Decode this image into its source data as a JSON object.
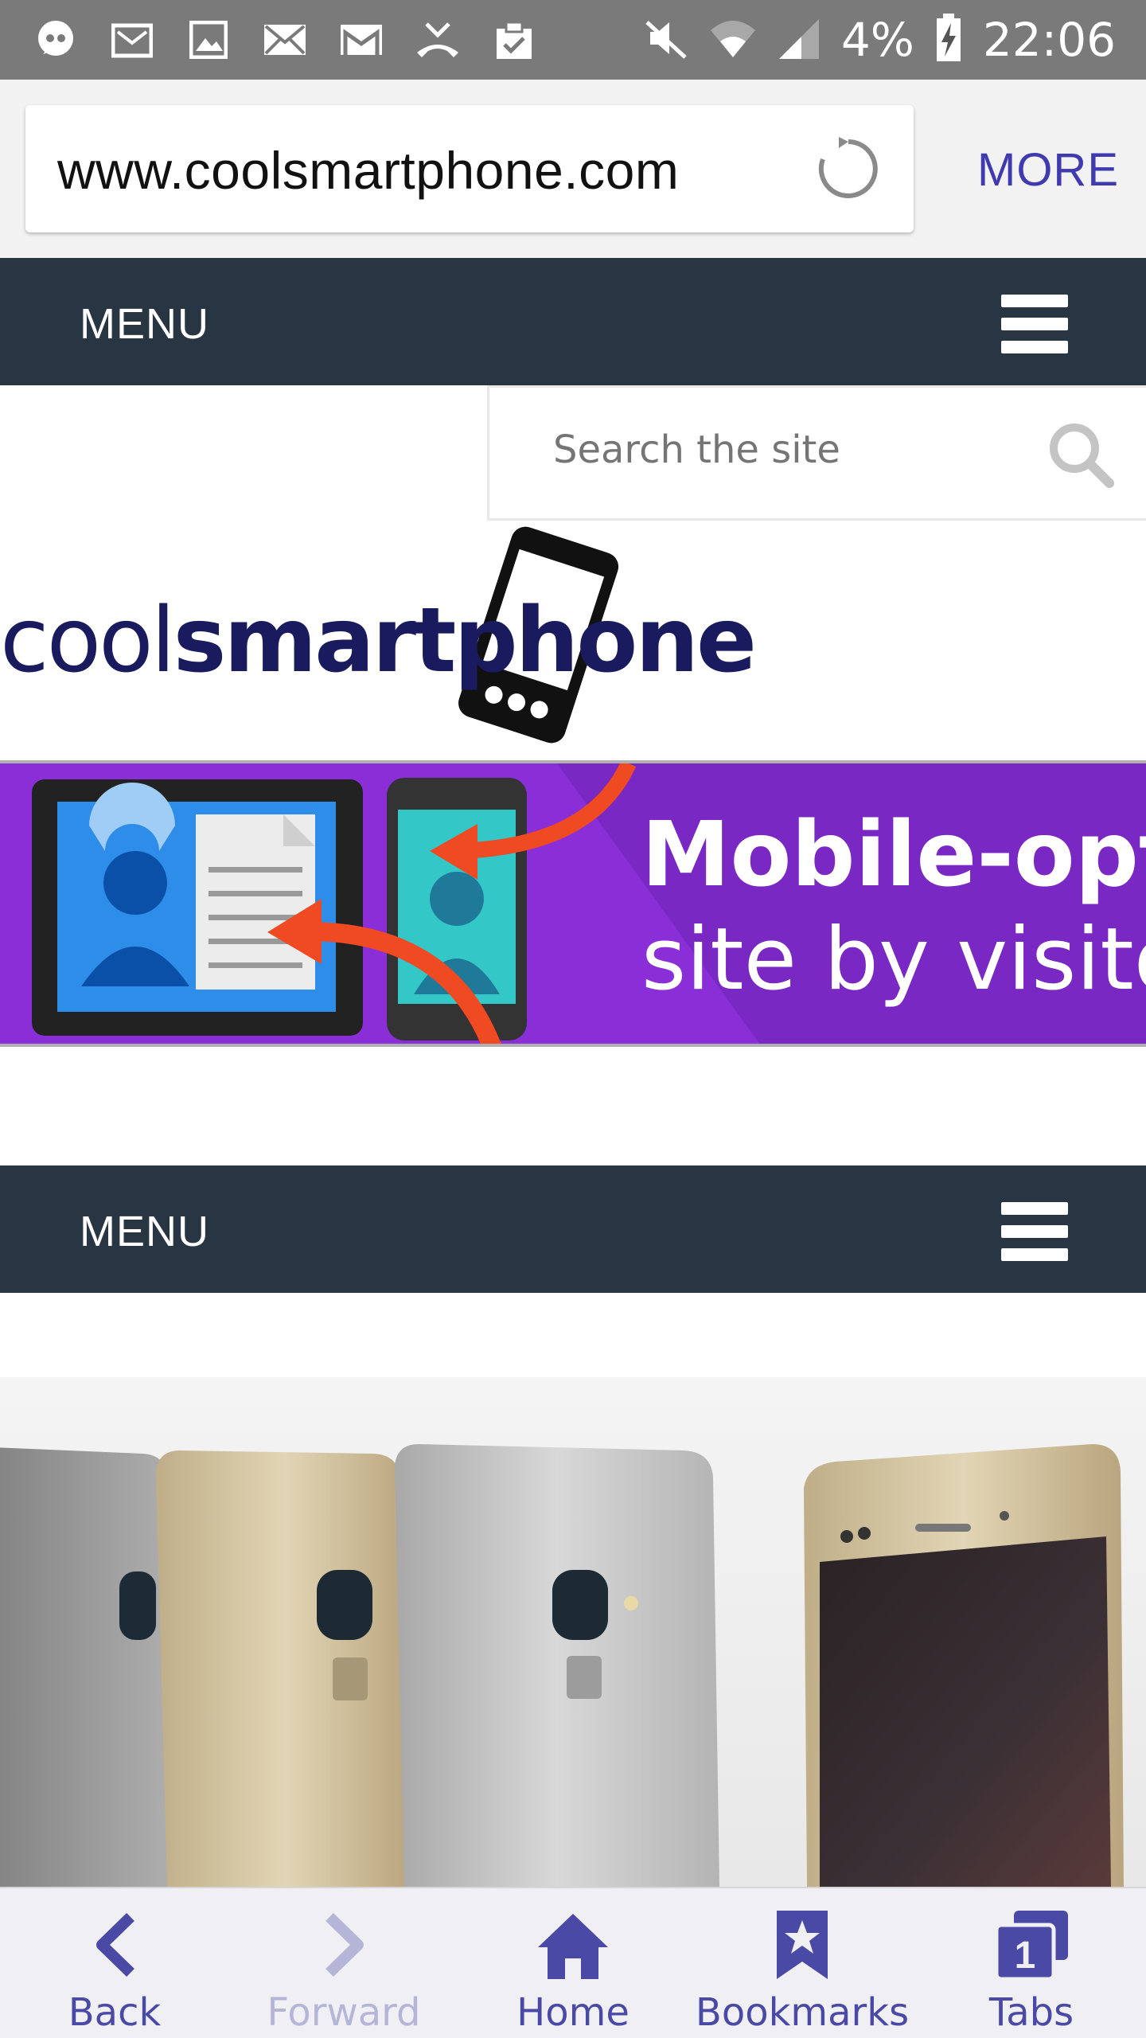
{
  "status_bar": {
    "battery": "4%",
    "time": "22:06",
    "left_icons": [
      "chat-icon",
      "mail-archive-icon",
      "image-icon",
      "email-icon",
      "gmail-icon",
      "missed-call-icon",
      "clipboard-check-icon"
    ],
    "right_icons": [
      "mute-icon",
      "wifi-icon",
      "signal-icon",
      "battery-charging-icon"
    ]
  },
  "browser": {
    "url": "www.coolsmartphone.com",
    "more_label": "MORE"
  },
  "site": {
    "menu_top_label": "MENU",
    "menu_second_label": "MENU",
    "search_placeholder": "Search the site",
    "logo_light": "cool",
    "logo_bold": "smartphone",
    "banner_line1": "Mobile-opti",
    "banner_line2": "site by visito"
  },
  "bottom_nav": {
    "items": [
      {
        "label": "Back",
        "enabled": true
      },
      {
        "label": "Forward",
        "enabled": false
      },
      {
        "label": "Home",
        "enabled": true
      },
      {
        "label": "Bookmarks",
        "enabled": true
      },
      {
        "label": "Tabs",
        "enabled": true
      }
    ],
    "tab_count": "1"
  },
  "colors": {
    "status_bar": "#7a7a7a",
    "menu_bar": "#283542",
    "accent": "#3f3ab0",
    "nav_icon": "#4a4aa6",
    "banner": "#8a2fd8"
  }
}
